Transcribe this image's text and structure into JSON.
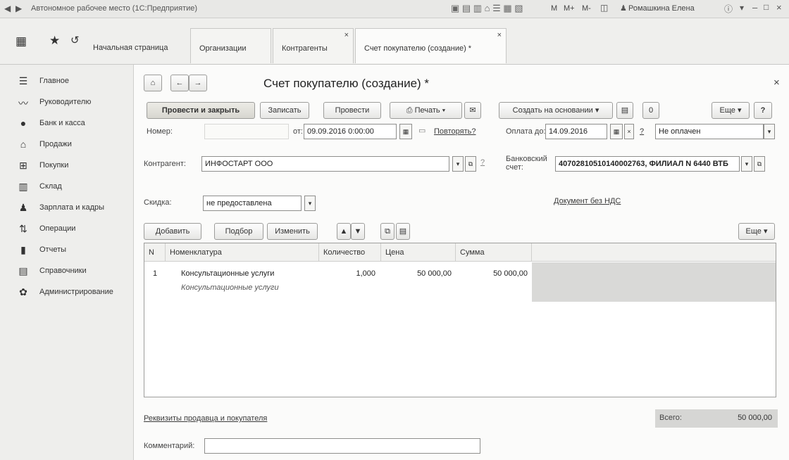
{
  "app": {
    "window_title": "Автономное рабочее место (1С:Предприятие)",
    "calc_buttons": [
      "M",
      "M+",
      "M-"
    ],
    "user": "Ромашкина Елена"
  },
  "nav": {
    "tabs": [
      {
        "label": "Начальная страница"
      },
      {
        "label": "Организации"
      },
      {
        "label": "Контрагенты"
      },
      {
        "label": "Счет покупателю (создание) *"
      }
    ]
  },
  "sidebar": {
    "items": [
      {
        "label": "Главное",
        "icon": "menu-icon"
      },
      {
        "label": "Руководителю",
        "icon": "chart-trend-icon"
      },
      {
        "label": "Банк и касса",
        "icon": "coins-icon"
      },
      {
        "label": "Продажи",
        "icon": "shop-icon"
      },
      {
        "label": "Покупки",
        "icon": "cart-icon"
      },
      {
        "label": "Склад",
        "icon": "warehouse-icon"
      },
      {
        "label": "Зарплата и кадры",
        "icon": "person-icon"
      },
      {
        "label": "Операции",
        "icon": "operations-icon"
      },
      {
        "label": "Отчеты",
        "icon": "bar-chart-icon"
      },
      {
        "label": "Справочники",
        "icon": "book-icon"
      },
      {
        "label": "Администрирование",
        "icon": "gear-icon"
      }
    ]
  },
  "doc": {
    "title": "Счет покупателю (создание) *",
    "toolbar": {
      "post_close": "Провести и закрыть",
      "save": "Записать",
      "post": "Провести",
      "print": "Печать",
      "create_based": "Создать на основании",
      "more": "Еще",
      "help": "?",
      "attach": "0"
    },
    "number_label": "Номер:",
    "number_value": "",
    "date_label": "от:",
    "date_value": "09.09.2016  0:00:00",
    "repeat_link": "Повторять?",
    "pay_label": "Оплата до:",
    "pay_value": "14.09.2016",
    "pay_q": "?",
    "pay_status": "Не оплачен",
    "counterparty_label": "Контрагент:",
    "counterparty_value": "ИНФОСТАРТ ООО",
    "counterparty_q": "?",
    "bank_label_1": "Банковский",
    "bank_label_2": "счет:",
    "bank_value": "40702810510140002763, ФИЛИАЛ N 6440 ВТБ",
    "discount_label": "Скидка:",
    "discount_value": "не предоставлена",
    "no_vat_link": "Документ без НДС",
    "table_toolbar": {
      "add": "Добавить",
      "pick": "Подбор",
      "edit": "Изменить",
      "more": "Еще"
    },
    "table": {
      "columns": [
        "N",
        "Номенклатура",
        "Количество",
        "Цена",
        "Сумма"
      ],
      "rows": [
        {
          "n": "1",
          "name": "Консультационные услуги",
          "desc": "Консультационные услуги",
          "qty": "1,000",
          "price": "50 000,00",
          "sum": "50 000,00"
        }
      ]
    },
    "requisites_link": "Реквизиты продавца и покупателя",
    "total_label": "Всего:",
    "total_value": "50 000,00",
    "comment_label": "Комментарий:",
    "comment_value": ""
  }
}
